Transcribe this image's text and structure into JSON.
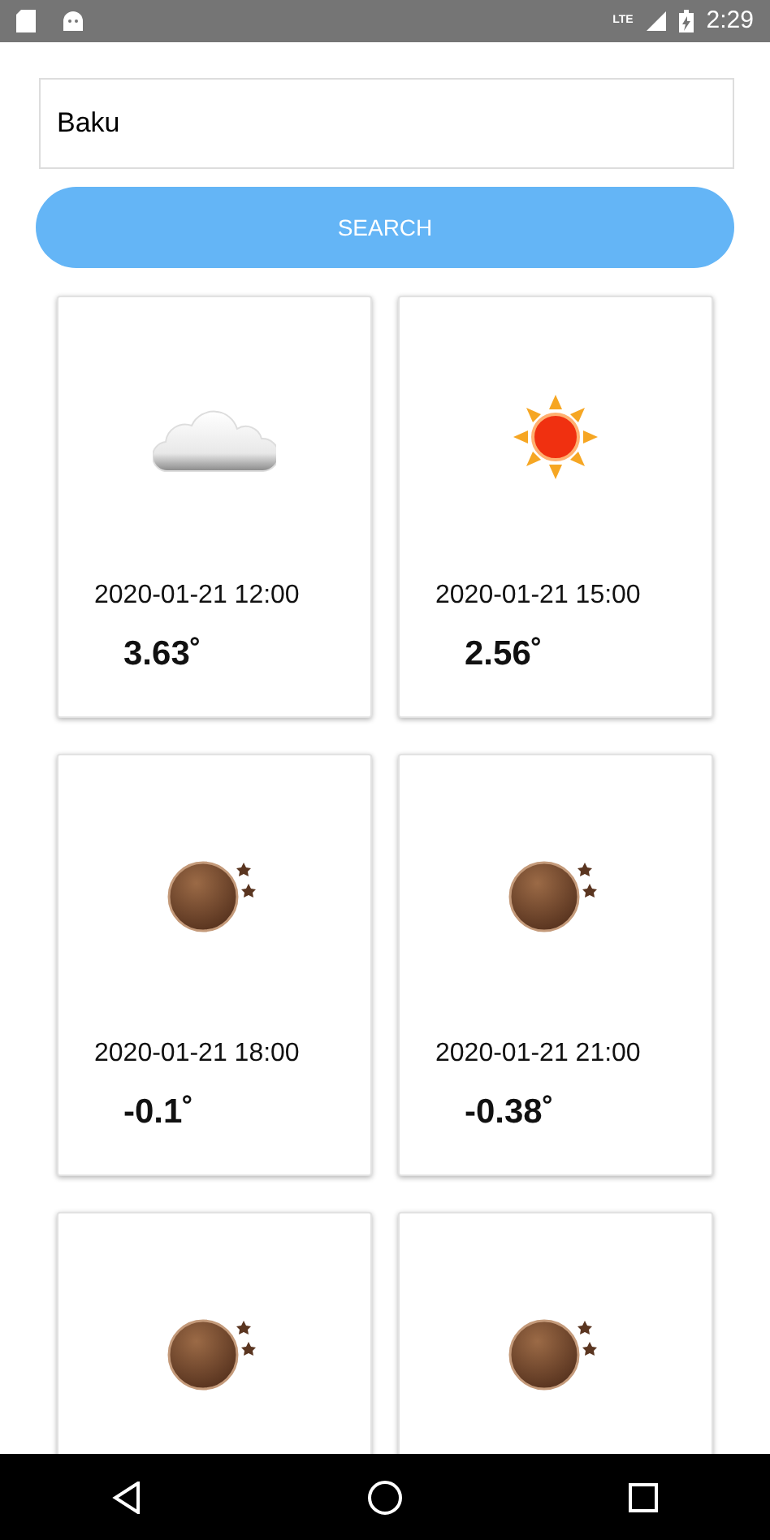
{
  "status_bar": {
    "time": "2:29",
    "network": "LTE"
  },
  "search": {
    "value": "Baku",
    "button": "SEARCH"
  },
  "forecasts": [
    {
      "kind": "cloud",
      "date": "2020-01-21 12:00",
      "temperature": "3.63˚"
    },
    {
      "kind": "sun",
      "date": "2020-01-21 15:00",
      "temperature": "2.56˚"
    },
    {
      "kind": "moon",
      "date": "2020-01-21 18:00",
      "temperature": "-0.1˚"
    },
    {
      "kind": "moon",
      "date": "2020-01-21 21:00",
      "temperature": "-0.38˚"
    },
    {
      "kind": "moon"
    },
    {
      "kind": "moon"
    }
  ]
}
